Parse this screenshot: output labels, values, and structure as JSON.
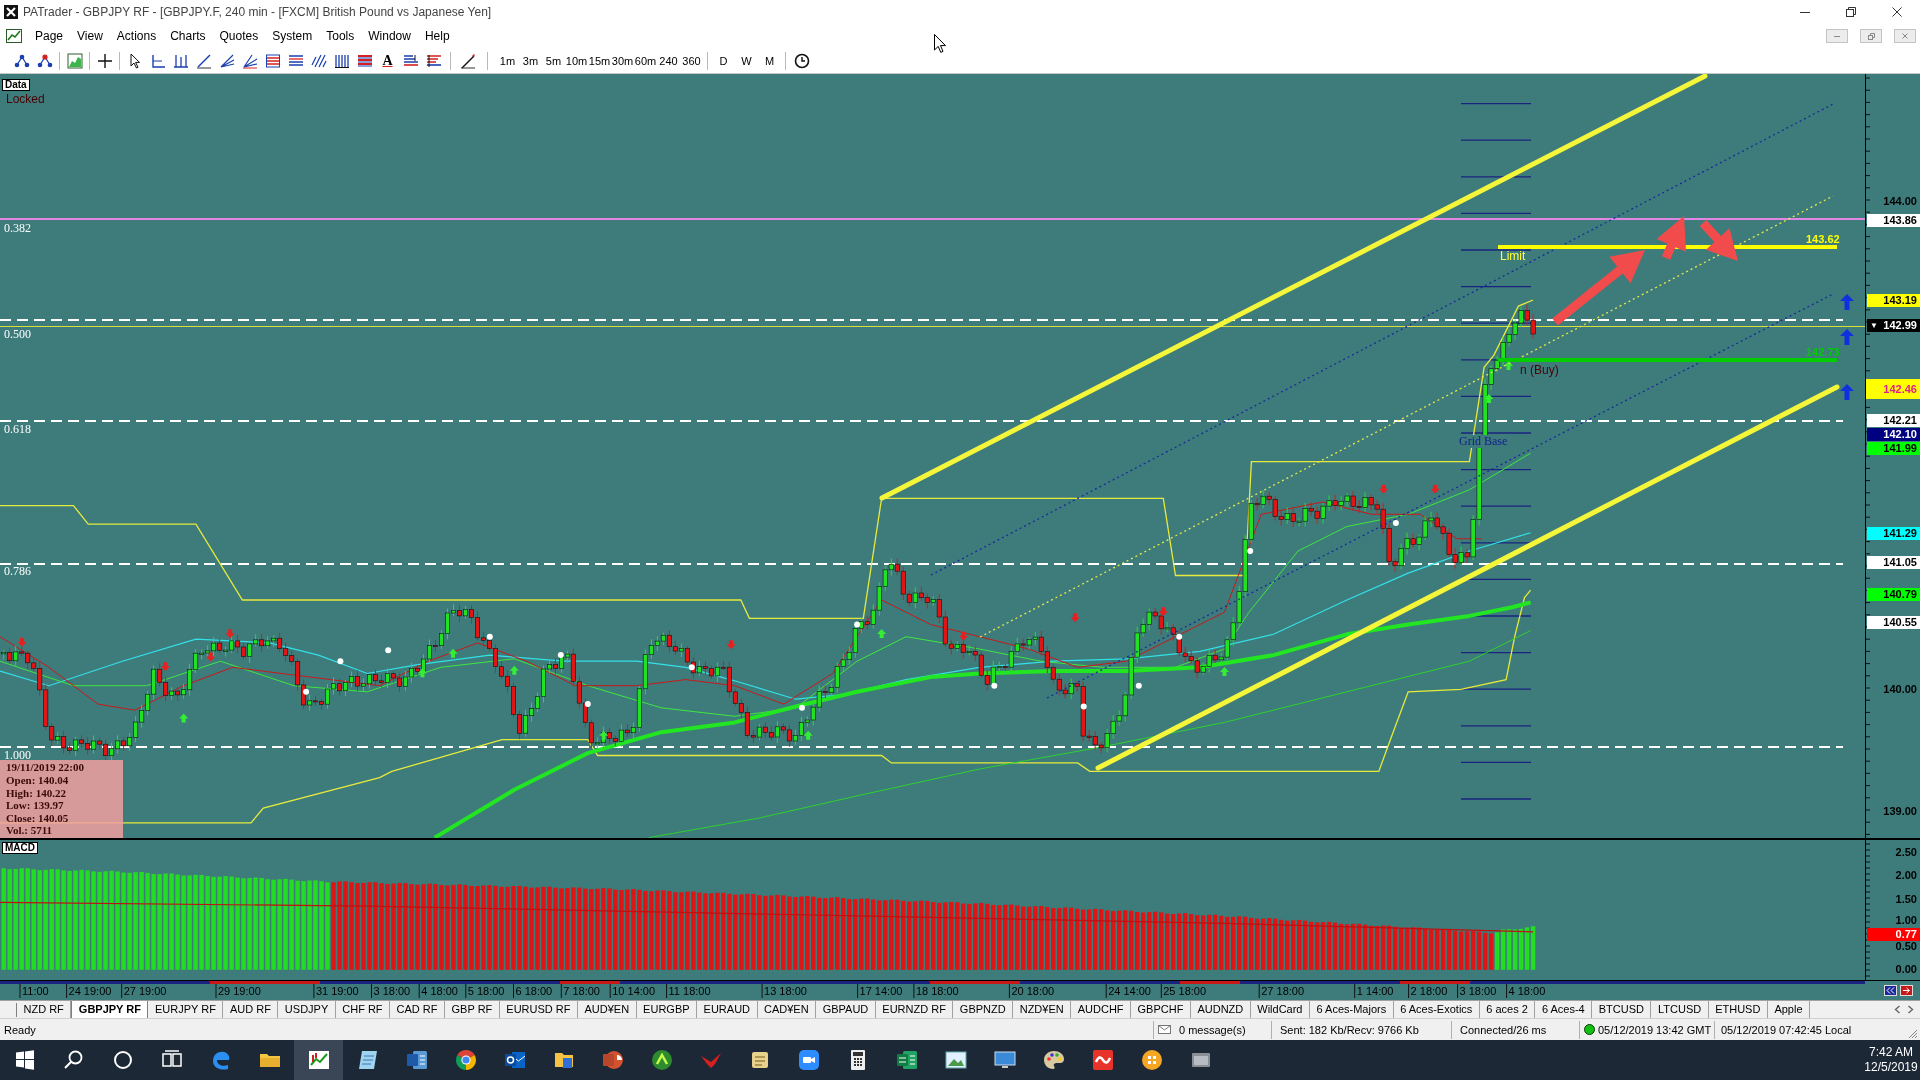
{
  "window": {
    "title": "PATrader - GBPJPY RF - [GBPJPY.F, 240 min - [FXCM] British Pound vs Japanese Yen]"
  },
  "menu": [
    "Page",
    "View",
    "Actions",
    "Charts",
    "Quotes",
    "System",
    "Tools",
    "Window",
    "Help"
  ],
  "toolbar": {
    "text_tool": "A",
    "timeframes": [
      "1m",
      "3m",
      "5m",
      "10m",
      "15m",
      "30m",
      "60m",
      "240",
      "360"
    ],
    "periods": [
      "D",
      "W",
      "M"
    ]
  },
  "chart": {
    "data_button": "Data",
    "lock_status": "Locked",
    "fib_levels": [
      {
        "label": "0.382",
        "kind": "solid",
        "color": "#e385e3"
      },
      {
        "label": "0.500",
        "kind": "dashed",
        "color": "#ffffff"
      },
      {
        "label": "0.618",
        "kind": "dashed",
        "color": "#ffffff"
      },
      {
        "label": "0.786",
        "kind": "dashed",
        "color": "#ffffff"
      },
      {
        "label": "1.000",
        "kind": "dashed",
        "color": "#ffffff"
      }
    ],
    "orders": [
      {
        "kind": "limit",
        "label": "Limit",
        "price": "143.62",
        "color": "#ffff00"
      },
      {
        "kind": "entry",
        "label": "n (Buy)",
        "price": "142.73",
        "color": "#00cc00"
      }
    ],
    "grid_base": "Grid Base",
    "info_box": {
      "time": "19/11/2019 22:00",
      "lines": [
        "Open: 140.04",
        "High: 140.22",
        "Low: 139.97",
        "Close: 140.05",
        "Vol.: 5711"
      ]
    },
    "price_axis": [
      {
        "kind": "tick",
        "label": "144.00"
      },
      {
        "kind": "tag",
        "label": "143.86",
        "color": "#ffffff"
      },
      {
        "kind": "tag",
        "label": "143.19",
        "color": "#ffff00"
      },
      {
        "kind": "last",
        "label": "142.99",
        "marker": "▼",
        "color": "#000000"
      },
      {
        "kind": "current",
        "label": "142.46",
        "color": "#ffff00"
      },
      {
        "kind": "tag",
        "label": "142.21",
        "color": "#ffffff"
      },
      {
        "kind": "tag",
        "label": "142.10",
        "color": "#000080"
      },
      {
        "kind": "tag",
        "label": "141.99",
        "color": "#00ff00"
      },
      {
        "kind": "tag",
        "label": "141.29",
        "color": "#00ffff"
      },
      {
        "kind": "tag",
        "label": "141.05",
        "color": "#ffffff"
      },
      {
        "kind": "tag",
        "label": "140.79",
        "color": "#00ff00"
      },
      {
        "kind": "tag",
        "label": "140.55",
        "color": "#ffffff"
      },
      {
        "kind": "tick",
        "label": "140.00"
      },
      {
        "kind": "tick",
        "label": "139.00"
      }
    ]
  },
  "macd": {
    "label": "MACD",
    "axis": [
      {
        "kind": "tick",
        "label": "2.50"
      },
      {
        "kind": "tick",
        "label": "2.00"
      },
      {
        "kind": "tick",
        "label": "1.50"
      },
      {
        "kind": "tick",
        "label": "1.00"
      },
      {
        "kind": "tag",
        "label": "0.77",
        "color": "#ff0000"
      },
      {
        "kind": "tick",
        "label": "0.50"
      },
      {
        "kind": "tick",
        "label": "0.00"
      }
    ]
  },
  "date_axis": [
    "11:00",
    "24 19:00",
    "27 19:00",
    "29 19:00",
    "31 19:00",
    "3 18:00",
    "4 18:00",
    "5 18:00",
    "6 18:00",
    "7 18:00",
    "10 14:00",
    "11 18:00",
    "13 18:00",
    "17 14:00",
    "18 18:00",
    "20 18:00",
    "24 14:00",
    "25 18:00",
    "27 18:00",
    "1 14:00",
    "2 18:00",
    "3 18:00",
    "4 18:00"
  ],
  "tabs": [
    {
      "label": "NZD RF",
      "selected": false
    },
    {
      "label": "GBPJPY RF",
      "selected": true
    },
    {
      "label": "EURJPY RF",
      "selected": false
    },
    {
      "label": "AUD RF",
      "selected": false
    },
    {
      "label": "USDJPY",
      "selected": false
    },
    {
      "label": "CHF RF",
      "selected": false
    },
    {
      "label": "CAD RF",
      "selected": false
    },
    {
      "label": "GBP RF",
      "selected": false
    },
    {
      "label": "EURUSD RF",
      "selected": false
    },
    {
      "label": "AUD¥EN",
      "selected": false
    },
    {
      "label": "EURGBP",
      "selected": false
    },
    {
      "label": "EURAUD",
      "selected": false
    },
    {
      "label": "CAD¥EN",
      "selected": false
    },
    {
      "label": "GBPAUD",
      "selected": false
    },
    {
      "label": "EURNZD RF",
      "selected": false
    },
    {
      "label": "GBPNZD",
      "selected": false
    },
    {
      "label": "NZD¥EN",
      "selected": false
    },
    {
      "label": "AUDCHF",
      "selected": false
    },
    {
      "label": "GBPCHF",
      "selected": false
    },
    {
      "label": "AUDNZD",
      "selected": false
    },
    {
      "label": "WildCard",
      "selected": false
    },
    {
      "label": "6 Aces-Majors",
      "selected": false
    },
    {
      "label": "6 Aces-Exotics",
      "selected": false
    },
    {
      "label": "6 aces 2",
      "selected": false
    },
    {
      "label": "6 Aces-4",
      "selected": false
    },
    {
      "label": "BTCUSD",
      "selected": false
    },
    {
      "label": "LTCUSD",
      "selected": false
    },
    {
      "label": "ETHUSD",
      "selected": false
    },
    {
      "label": "Apple",
      "selected": false
    }
  ],
  "status_bar": {
    "status": "Ready",
    "messages": "0 message(s)",
    "traffic": "Sent: 182 Kb/Recv: 9766 Kb",
    "connection": "Connected/26 ms",
    "gmt_time": "05/12/2019 13:42 GMT",
    "local_time": "05/12/2019 07:42:45 Local"
  },
  "taskbar": {
    "time": "7:42 AM",
    "date": "12/5/2019"
  }
}
